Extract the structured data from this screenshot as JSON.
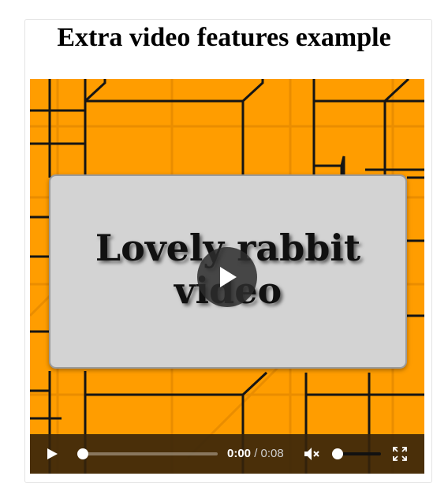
{
  "page": {
    "title": "Extra video features example"
  },
  "video": {
    "poster_text_line1": "Lovely rabbit",
    "poster_text_line2": "video",
    "background_color": "#ff9d00",
    "poster_card_color": "#d3d3d3",
    "big_play_icon": "play-icon"
  },
  "controls": {
    "play_icon": "play-icon",
    "current_time": "0:00",
    "separator": " / ",
    "duration": "0:08",
    "progress_fraction": 0,
    "mute_icon": "speaker-muted-icon",
    "volume_fraction": 0,
    "fullscreen_icon": "fullscreen-icon"
  }
}
